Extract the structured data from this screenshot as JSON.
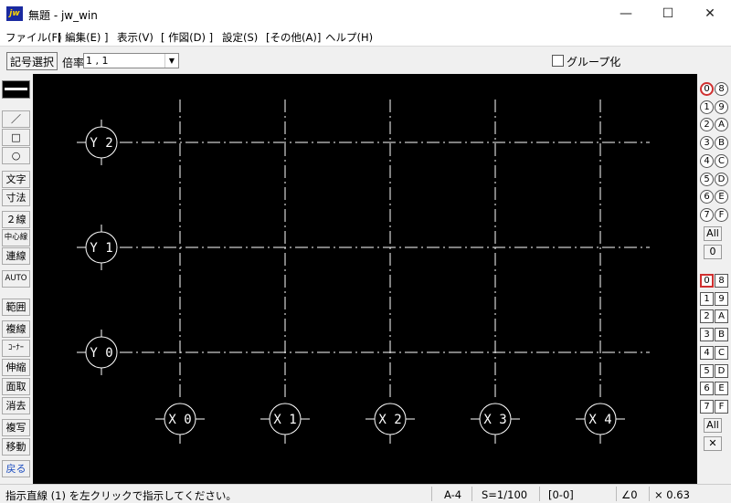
{
  "window": {
    "title": "無題 - jw_win",
    "app_icon": "jw",
    "minimize": "—",
    "maximize": "☐",
    "close": "✕"
  },
  "menu": [
    "ファイル(F)",
    "[ 編集(E) ]",
    "表示(V)",
    "[ 作図(D) ]",
    "設定(S)",
    "[その他(A)]",
    "ヘルプ(H)"
  ],
  "toolbar": {
    "kigo_button": "記号選択",
    "scale_label": "倍率",
    "scale_value": "1 , 1",
    "group_label": "グループ化"
  },
  "tools": {
    "line": "／",
    "rect": "□",
    "circle": "○",
    "text": "文字",
    "dim": "寸法",
    "double_line": "２線",
    "center_line": "中心線",
    "cont_line": "連線",
    "auto": "AUTO",
    "range": "範囲",
    "copy_line": "複線",
    "corner": "ｺｰﾅｰ",
    "stretch": "伸縮",
    "chamfer": "面取",
    "erase": "消去",
    "duplicate": "複写",
    "move": "移動",
    "undo": "戻る"
  },
  "layers": [
    "0",
    "8",
    "1",
    "9",
    "2",
    "A",
    "3",
    "B",
    "4",
    "C",
    "5",
    "D",
    "6",
    "E",
    "7",
    "F"
  ],
  "layer_all": "All",
  "layer_current": "0",
  "groups": [
    "0",
    "8",
    "1",
    "9",
    "2",
    "A",
    "3",
    "B",
    "4",
    "C",
    "5",
    "D",
    "6",
    "E",
    "7",
    "F"
  ],
  "group_all": "All",
  "group_extra": "✕",
  "grid": {
    "x_labels": [
      "X 0",
      "X 1",
      "X 2",
      "X 3",
      "X 4"
    ],
    "y_labels": [
      "Y 2",
      "Y 1",
      "Y 0"
    ]
  },
  "status": {
    "message": "指示直線 (1) を左クリックで指示してください。",
    "paper": "A-4",
    "scale": "S=1/100",
    "layer": "[0-0]",
    "angle": "∠0",
    "zoom": "× 0.63"
  },
  "colors": {
    "canvas": "#000000",
    "active_layer": "#d03030",
    "grid_line": "#ffffff"
  }
}
